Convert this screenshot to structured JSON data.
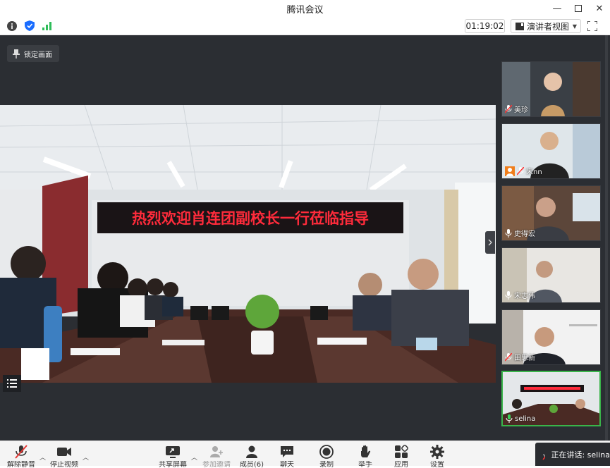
{
  "window": {
    "title": "腾讯会议"
  },
  "toolbar": {
    "timer": "01:19:02",
    "view_label": "演讲者视图"
  },
  "main": {
    "lock_label": "锁定画面",
    "banner_text": "热烈欢迎肖连团副校长一行莅临指导"
  },
  "participants": [
    {
      "name": "美珍"
    },
    {
      "name": "宋nn"
    },
    {
      "name": "史得宏"
    },
    {
      "name": "宋志伟"
    },
    {
      "name": "田思新"
    },
    {
      "name": "selina"
    }
  ],
  "bottombar": {
    "mute_label": "解除静音",
    "video_label": "停止视频",
    "share_label": "共享屏幕",
    "invite_label": "参加邀请",
    "members_label": "成员(6)",
    "chat_label": "聊天",
    "record_label": "录制",
    "hand_label": "举手",
    "apps_label": "应用",
    "settings_label": "设置",
    "speaking_label": "正在讲话: selina"
  },
  "colors": {
    "accent": "#1a6dff",
    "active_border": "#39b54a",
    "led_text": "#ff2b3b"
  }
}
